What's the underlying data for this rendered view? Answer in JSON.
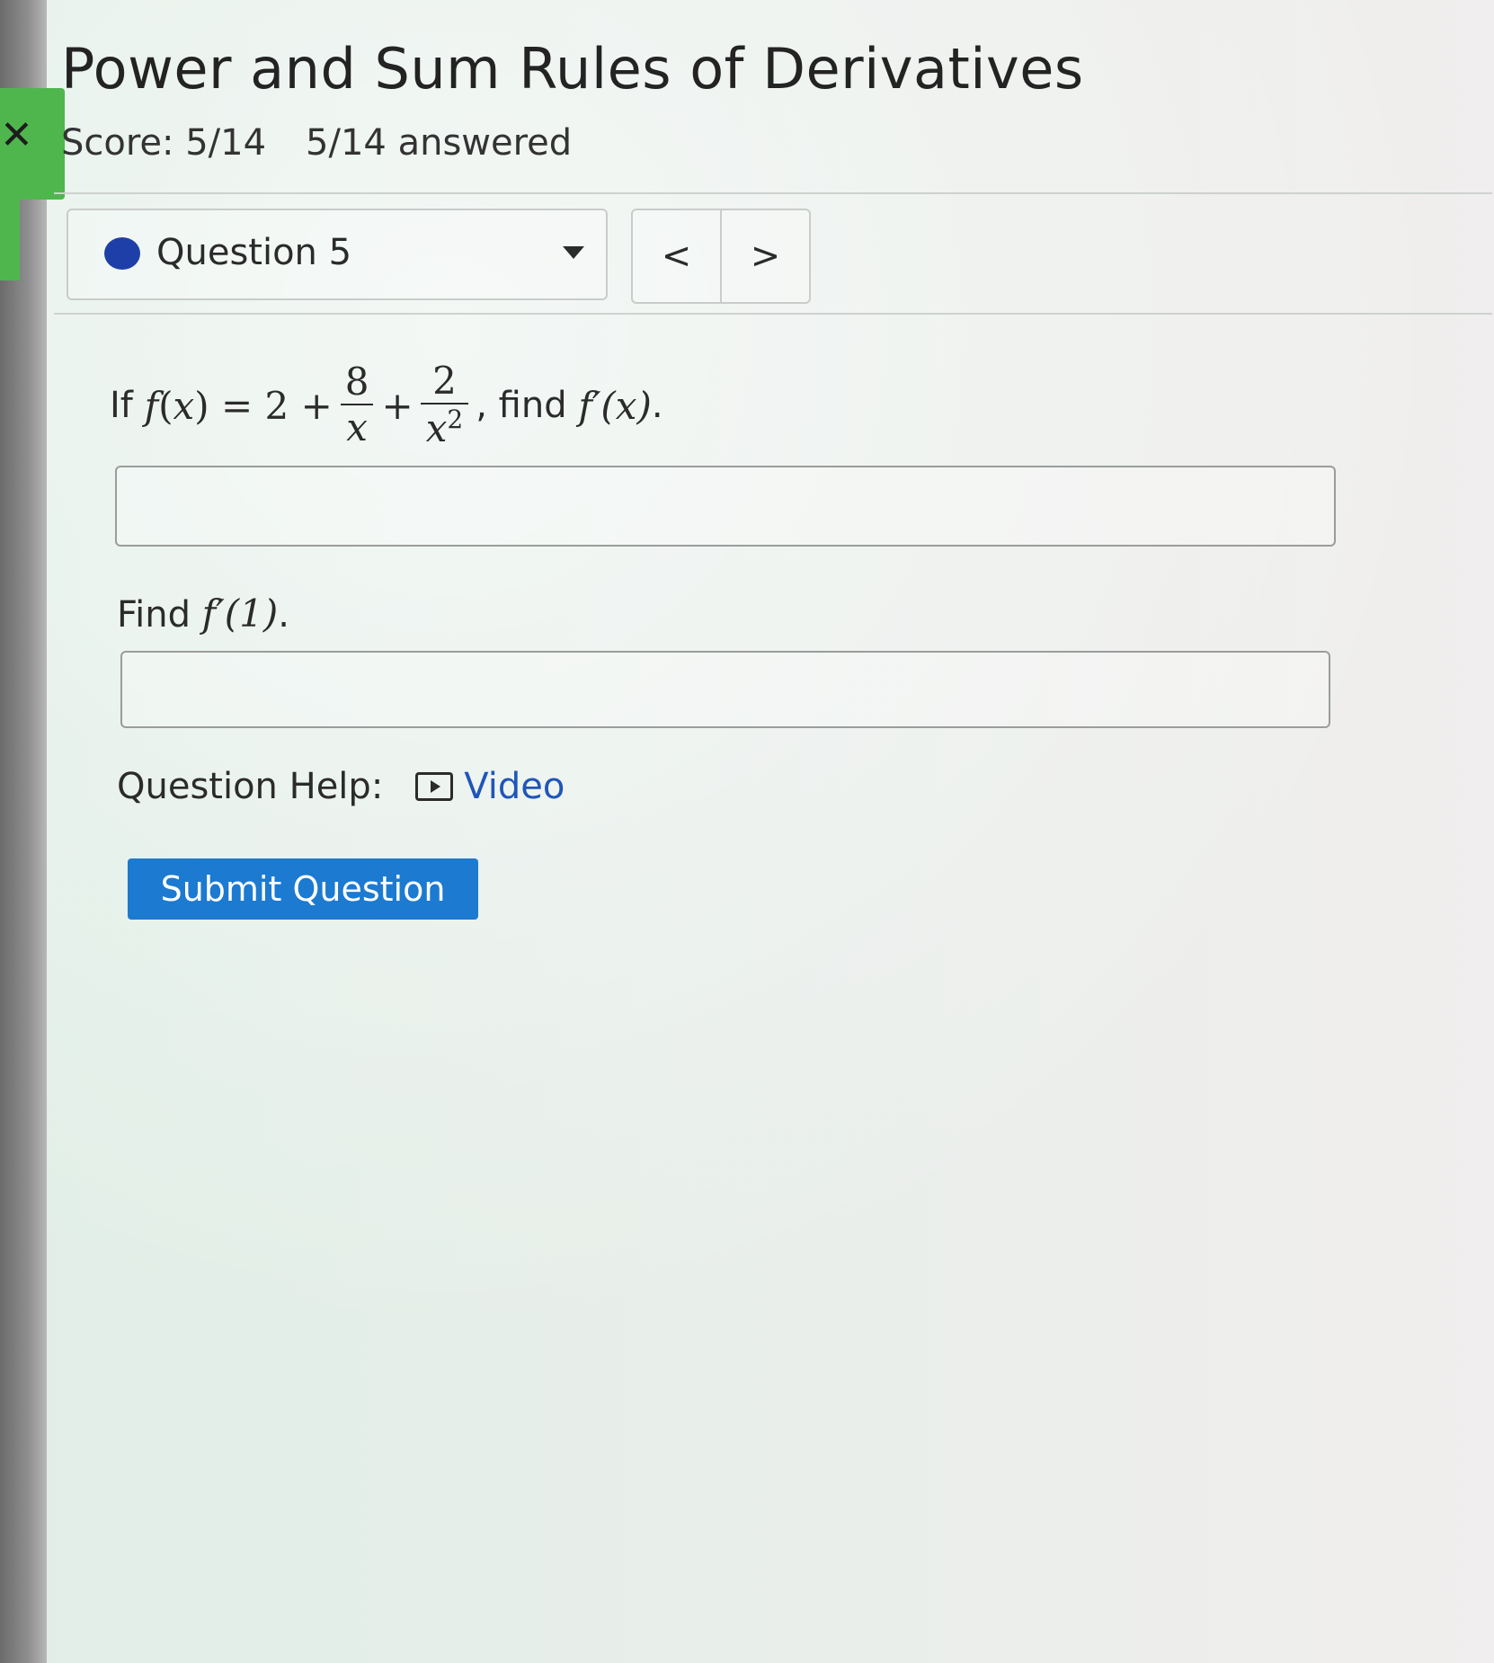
{
  "page": {
    "title": "Power and Sum Rules of Derivatives",
    "score": "Score: 5/14",
    "answered": "5/14 answered"
  },
  "question_nav": {
    "selected": "Question 5",
    "prev_label": "<",
    "next_label": ">"
  },
  "question": {
    "intro": "If",
    "fx": "f",
    "lparen": "(",
    "var": "x",
    "rparen_eq": ") = 2 +",
    "frac1_num": "8",
    "frac1_den": "x",
    "plus": "+",
    "frac2_num": "2",
    "frac2_den": "x",
    "frac2_exp": "2",
    "find_text": ", find",
    "target": "f′(x)",
    "period": ".",
    "answer1": "",
    "part2_prefix": "Find",
    "part2_target": "f′(1)",
    "part2_suffix": ".",
    "answer2": ""
  },
  "help": {
    "label": "Question Help:",
    "video_label": "Video"
  },
  "actions": {
    "submit_label": "Submit Question"
  },
  "colors": {
    "accent_blue": "#1c7ad0",
    "status_dot": "#1f3fa8",
    "green_tab": "#4fb64e",
    "link": "#1f56b8"
  },
  "icons": {
    "close": "close-icon",
    "dropdown": "caret-down-icon",
    "video": "video-play-icon"
  }
}
